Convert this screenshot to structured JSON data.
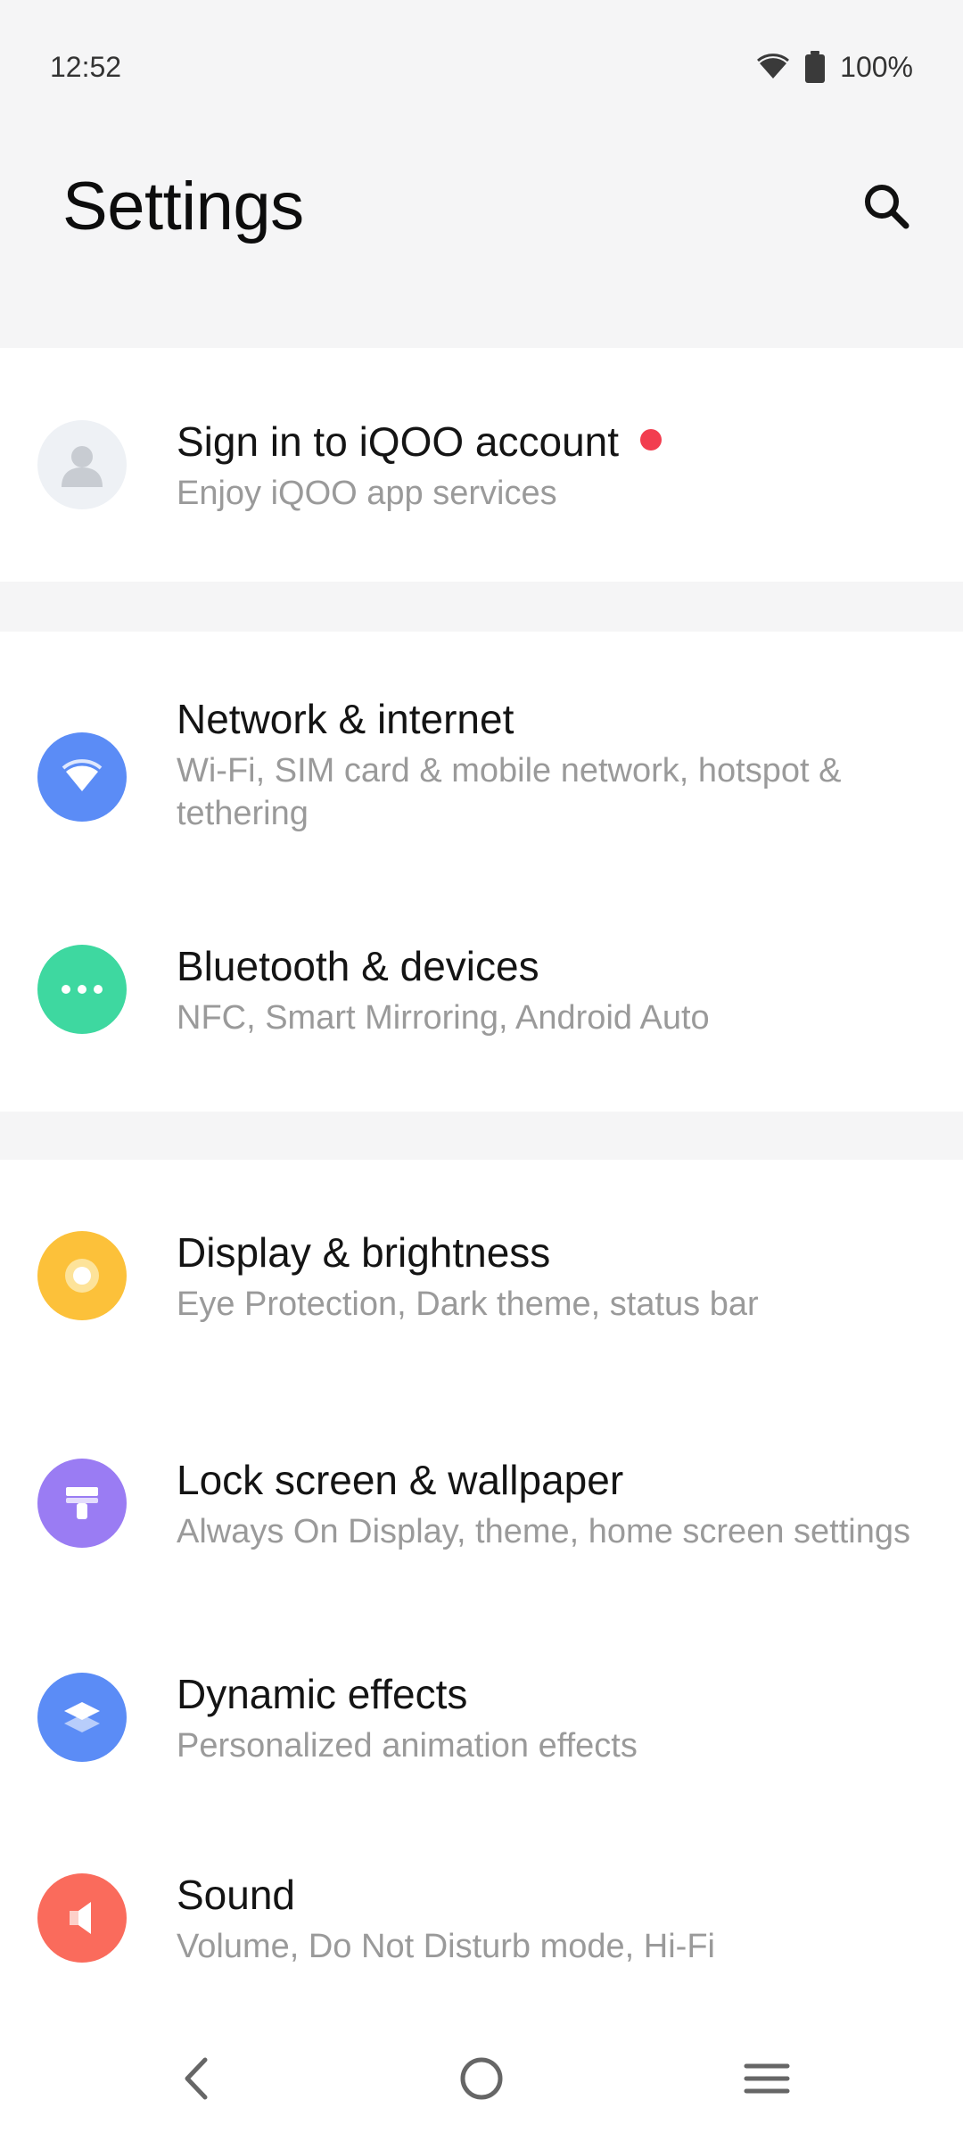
{
  "status_bar": {
    "time": "12:52",
    "battery": "100%",
    "icons": [
      "wifi-icon",
      "battery-icon"
    ]
  },
  "header": {
    "title": "Settings",
    "search_icon": "search-icon"
  },
  "account": {
    "title": "Sign in to iQOO account",
    "subtitle": "Enjoy iQOO app services",
    "icon": "avatar-icon",
    "badge_color": "#f23d4f"
  },
  "groups": [
    {
      "items": [
        {
          "title": "Network & internet",
          "subtitle": "Wi-Fi, SIM card & mobile network, hotspot & tethering",
          "icon": "wifi-icon",
          "color": "#5b8cf6"
        },
        {
          "title": "Bluetooth & devices",
          "subtitle": "NFC, Smart Mirroring, Android Auto",
          "icon": "dots-icon",
          "color": "#3ed8a0"
        }
      ]
    },
    {
      "items": [
        {
          "title": "Display & brightness",
          "subtitle": "Eye Protection, Dark theme, status bar",
          "icon": "sun-icon",
          "color": "#fcc13a"
        },
        {
          "title": "Lock screen & wallpaper",
          "subtitle": "Always On Display, theme, home screen settings",
          "icon": "brush-icon",
          "color": "#9a7cf3"
        },
        {
          "title": "Dynamic effects",
          "subtitle": "Personalized animation effects",
          "icon": "layers-icon",
          "color": "#5b8cf6"
        },
        {
          "title": "Sound",
          "subtitle": "Volume, Do Not Disturb mode, Hi-Fi",
          "icon": "speaker-icon",
          "color": "#fa6b5c"
        }
      ]
    }
  ],
  "nav_bar": {
    "icons": [
      "back-icon",
      "home-icon",
      "menu-icon"
    ]
  }
}
